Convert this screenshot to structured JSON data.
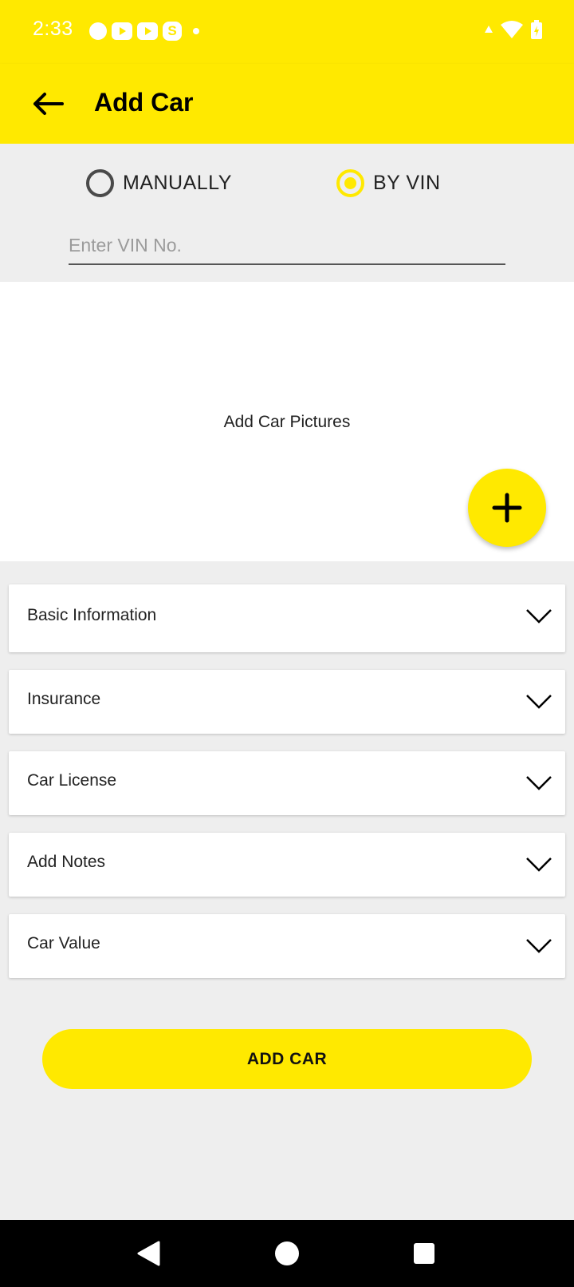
{
  "status_bar": {
    "time": "2:33",
    "notification_icons": [
      "cat-notification-icon",
      "youtube-icon",
      "youtube-icon",
      "skype-icon",
      "dot-icon"
    ],
    "system_icons": [
      "signal-icon",
      "wifi-icon",
      "battery-icon"
    ]
  },
  "app_bar": {
    "title": "Add Car",
    "back_icon": "arrow-left-icon"
  },
  "mode": {
    "options": [
      {
        "label": "MANUALLY",
        "selected": false
      },
      {
        "label": "BY VIN",
        "selected": true
      }
    ],
    "vin_placeholder": "Enter VIN No.",
    "vin_value": ""
  },
  "pictures": {
    "label": "Add Car Pictures",
    "fab_icon": "plus-icon"
  },
  "sections": [
    {
      "title": "Basic Information"
    },
    {
      "title": "Insurance"
    },
    {
      "title": "Car License"
    },
    {
      "title": "Add Notes"
    },
    {
      "title": "Car Value"
    }
  ],
  "submit": {
    "label": "ADD CAR"
  },
  "colors": {
    "accent": "#ffe900",
    "background": "#eeeeee"
  }
}
